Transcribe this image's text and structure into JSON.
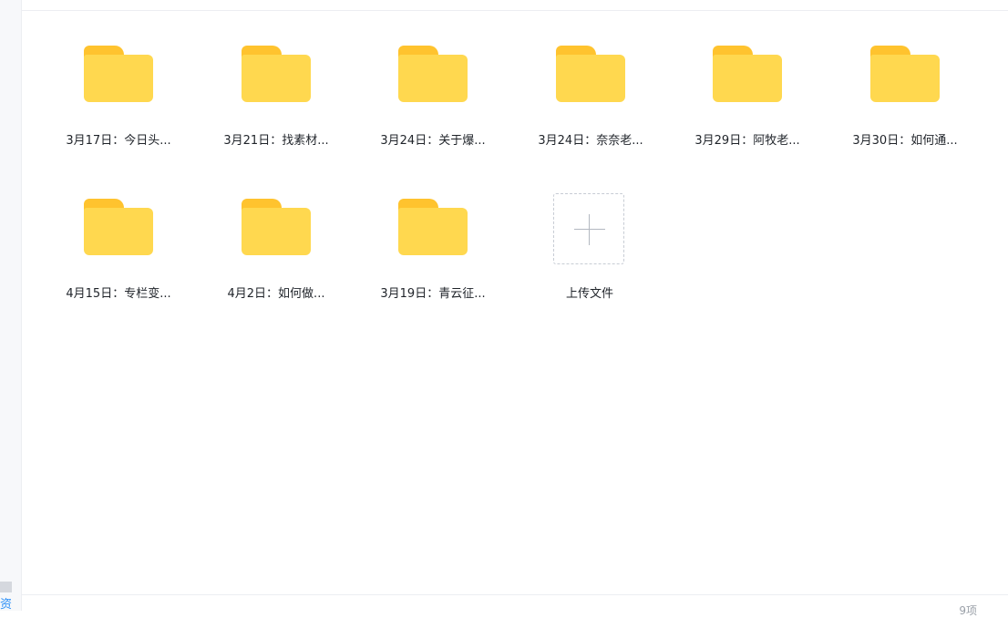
{
  "files": [
    {
      "name": "3月17日：今日头...",
      "icon": "folder-icon"
    },
    {
      "name": "3月21日：找素材...",
      "icon": "folder-icon"
    },
    {
      "name": "3月24日：关于爆...",
      "icon": "folder-icon"
    },
    {
      "name": "3月24日：奈奈老...",
      "icon": "folder-icon"
    },
    {
      "name": "3月29日：阿牧老...",
      "icon": "folder-icon"
    },
    {
      "name": "3月30日：如何通...",
      "icon": "folder-icon"
    },
    {
      "name": "4月15日：专栏变...",
      "icon": "folder-icon"
    },
    {
      "name": "4月2日：如何做...",
      "icon": "folder-icon"
    },
    {
      "name": "3月19日：青云征...",
      "icon": "folder-icon"
    }
  ],
  "upload": {
    "label": "上传文件",
    "icon": "plus-icon"
  },
  "footer": {
    "count": "9项"
  },
  "sidebar": {
    "link_text": "资"
  },
  "colors": {
    "folder_tab": "#ffc32e",
    "folder_body": "#ffd84f",
    "link": "#2b8ff7"
  }
}
